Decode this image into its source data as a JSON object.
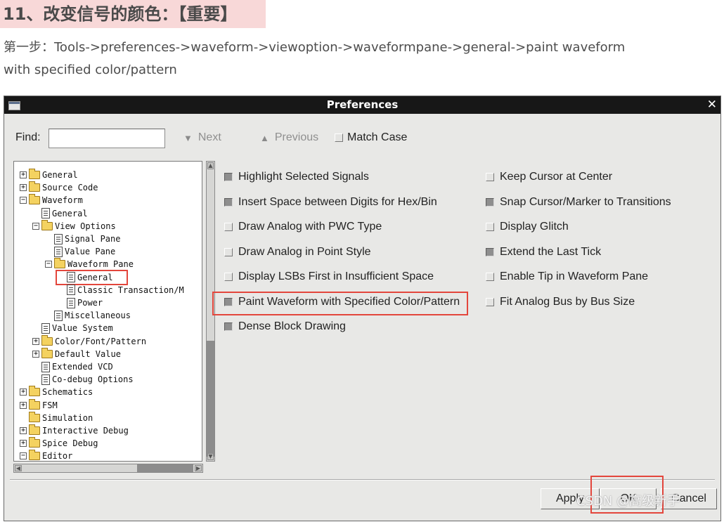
{
  "article": {
    "heading": "11、改变信号的颜色：【重要】",
    "step_line1": "第一步：Tools->preferences->waveform->viewoption->waveformpane->general->paint waveform",
    "step_line2": "with specified color/pattern"
  },
  "dialog": {
    "title": "Preferences",
    "find_label": "Find:",
    "find_value": "",
    "next_label": "Next",
    "previous_label": "Previous",
    "match_case_label": "Match Case",
    "match_case_checked": false
  },
  "tree": {
    "items": [
      {
        "label": "General",
        "expander": "+",
        "icon": "folder-icon"
      },
      {
        "label": "Source Code",
        "expander": "+",
        "icon": "folder-icon"
      },
      {
        "label": "Waveform",
        "expander": "-",
        "icon": "folder-open-icon"
      },
      {
        "label": "General",
        "expander": "",
        "icon": "document-icon"
      },
      {
        "label": "View Options",
        "expander": "-",
        "icon": "folder-open-icon"
      },
      {
        "label": "Signal Pane",
        "expander": "",
        "icon": "document-icon"
      },
      {
        "label": "Value Pane",
        "expander": "",
        "icon": "document-icon"
      },
      {
        "label": "Waveform Pane",
        "expander": "-",
        "icon": "folder-open-icon"
      },
      {
        "label": "General",
        "expander": "",
        "icon": "document-icon",
        "selected": true
      },
      {
        "label": "Classic Transaction/M",
        "expander": "",
        "icon": "document-icon"
      },
      {
        "label": "Power",
        "expander": "",
        "icon": "document-icon"
      },
      {
        "label": "Miscellaneous",
        "expander": "",
        "icon": "document-icon"
      },
      {
        "label": "Value System",
        "expander": "",
        "icon": "document-icon"
      },
      {
        "label": "Color/Font/Pattern",
        "expander": "+",
        "icon": "folder-icon"
      },
      {
        "label": "Default Value",
        "expander": "+",
        "icon": "folder-icon"
      },
      {
        "label": "Extended VCD",
        "expander": "",
        "icon": "document-icon"
      },
      {
        "label": "Co-debug Options",
        "expander": "",
        "icon": "document-icon"
      },
      {
        "label": "Schematics",
        "expander": "+",
        "icon": "folder-icon"
      },
      {
        "label": "FSM",
        "expander": "+",
        "icon": "folder-icon"
      },
      {
        "label": "Simulation",
        "expander": "",
        "icon": "folder-icon"
      },
      {
        "label": "Interactive Debug",
        "expander": "+",
        "icon": "folder-icon"
      },
      {
        "label": "Spice Debug",
        "expander": "+",
        "icon": "folder-icon"
      },
      {
        "label": "Editor",
        "expander": "-",
        "icon": "folder-open-icon"
      }
    ]
  },
  "options_left": [
    {
      "label": "Highlight Selected Signals",
      "checked": true
    },
    {
      "label": "Insert Space between Digits for Hex/Bin",
      "checked": true
    },
    {
      "label": "Draw Analog with PWC Type",
      "checked": false
    },
    {
      "label": "Draw Analog in Point Style",
      "checked": false
    },
    {
      "label": "Display LSBs First in Insufficient Space",
      "checked": false
    },
    {
      "label": "Paint Waveform with Specified Color/Pattern",
      "checked": true
    },
    {
      "label": "Dense Block Drawing",
      "checked": true
    }
  ],
  "options_right": [
    {
      "label": "Keep Cursor at Center",
      "checked": false
    },
    {
      "label": "Snap Cursor/Marker to Transitions",
      "checked": true
    },
    {
      "label": "Display Glitch",
      "checked": false
    },
    {
      "label": "Extend the Last Tick",
      "checked": true
    },
    {
      "label": "Enable Tip in Waveform Pane",
      "checked": false
    },
    {
      "label": "Fit Analog Bus by Bus Size",
      "checked": false
    }
  ],
  "buttons": {
    "apply": "Apply",
    "ok": "OK",
    "cancel": "Cancel"
  },
  "watermark": "CSDN @高级新手",
  "colors": {
    "highlight_box": "#e3463c",
    "heading_bg": "#f8d8d8",
    "titlebar_bg": "#171717"
  }
}
